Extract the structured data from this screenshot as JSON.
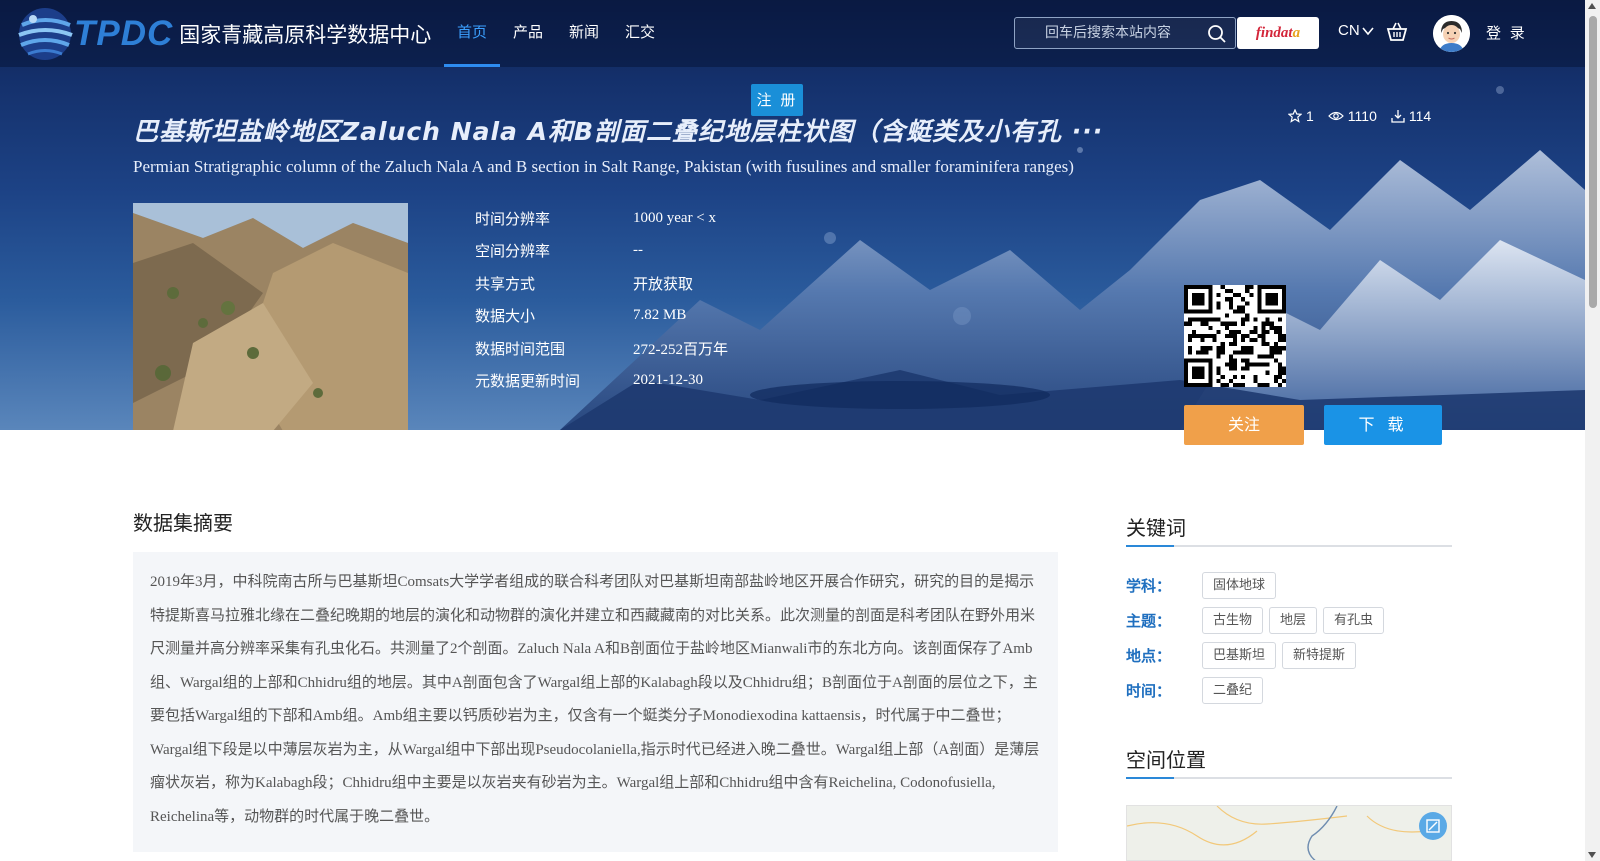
{
  "header": {
    "logo_text": "TPDC",
    "logo_cn": "国家青藏高原科学数据中心",
    "nav": [
      {
        "label": "首页",
        "active": true
      },
      {
        "label": "产品",
        "active": false
      },
      {
        "label": "新闻",
        "active": false
      },
      {
        "label": "汇交",
        "active": false
      }
    ],
    "search_placeholder": "回车后搜索本站内容",
    "findata_label": "findata",
    "lang_label": "CN",
    "login_label": "登 录",
    "register_label": "注 册"
  },
  "dataset": {
    "title_cn": "巴基斯坦盐岭地区Zaluch Nala A和B剖面二叠纪地层柱状图（含蜓类及小有孔 ···",
    "title_en": "Permian Stratigraphic column of the Zaluch Nala A and B section in Salt Range, Pakistan (with fusulines and smaller foraminifera ranges)",
    "stats": {
      "stars": "1",
      "views": "1110",
      "downloads": "114"
    },
    "meta": [
      {
        "key": "时间分辨率",
        "value": "1000 year < x"
      },
      {
        "key": "空间分辨率",
        "value": "--"
      },
      {
        "key": "共享方式",
        "value": "开放获取"
      },
      {
        "key": "数据大小",
        "value": "7.82 MB"
      },
      {
        "key": "数据时间范围",
        "value": "272-252百万年"
      },
      {
        "key": "元数据更新时间",
        "value": "2021-12-30"
      }
    ],
    "follow_label": "关注",
    "download_label": "下 载"
  },
  "abstract": {
    "title": "数据集摘要",
    "text": "2019年3月，中科院南古所与巴基斯坦Comsats大学学者组成的联合科考团队对巴基斯坦南部盐岭地区开展合作研究，研究的目的是揭示特提斯喜马拉雅北缘在二叠纪晚期的地层的演化和动物群的演化并建立和西藏藏南的对比关系。此次测量的剖面是科考团队在野外用米尺测量并高分辨率采集有孔虫化石。共测量了2个剖面。Zaluch Nala A和B剖面位于盐岭地区Mianwali市的东北方向。该剖面保存了Amb组、Wargal组的上部和Chhidru组的地层。其中A剖面包含了Wargal组上部的Kalabagh段以及Chhidru组；B剖面位于A剖面的层位之下，主要包括Wargal组的下部和Amb组。Amb组主要以钙质砂岩为主，仅含有一个蜓类分子Monodiexodina kattaensis，时代属于中二叠世；Wargal组下段是以中薄层灰岩为主，从Wargal组中下部出现Pseudocolaniella,指示时代已经进入晚二叠世。Wargal组上部（A剖面）是薄层瘤状灰岩，称为Kalabagh段；Chhidru组中主要是以灰岩夹有砂岩为主。Wargal组上部和Chhidru组中含有Reichelina, Codonofusiella, Reichelina等，动物群的时代属于晚二叠世。"
  },
  "keywords": {
    "title": "关键词",
    "rows": [
      {
        "label": "学科：",
        "tags": [
          "固体地球"
        ]
      },
      {
        "label": "主题：",
        "tags": [
          "古生物",
          "地层",
          "有孔虫"
        ]
      },
      {
        "label": "地点：",
        "tags": [
          "巴基斯坦",
          "新特提斯"
        ]
      },
      {
        "label": "时间：",
        "tags": [
          "二叠纪"
        ]
      }
    ]
  },
  "spatial": {
    "title": "空间位置"
  }
}
